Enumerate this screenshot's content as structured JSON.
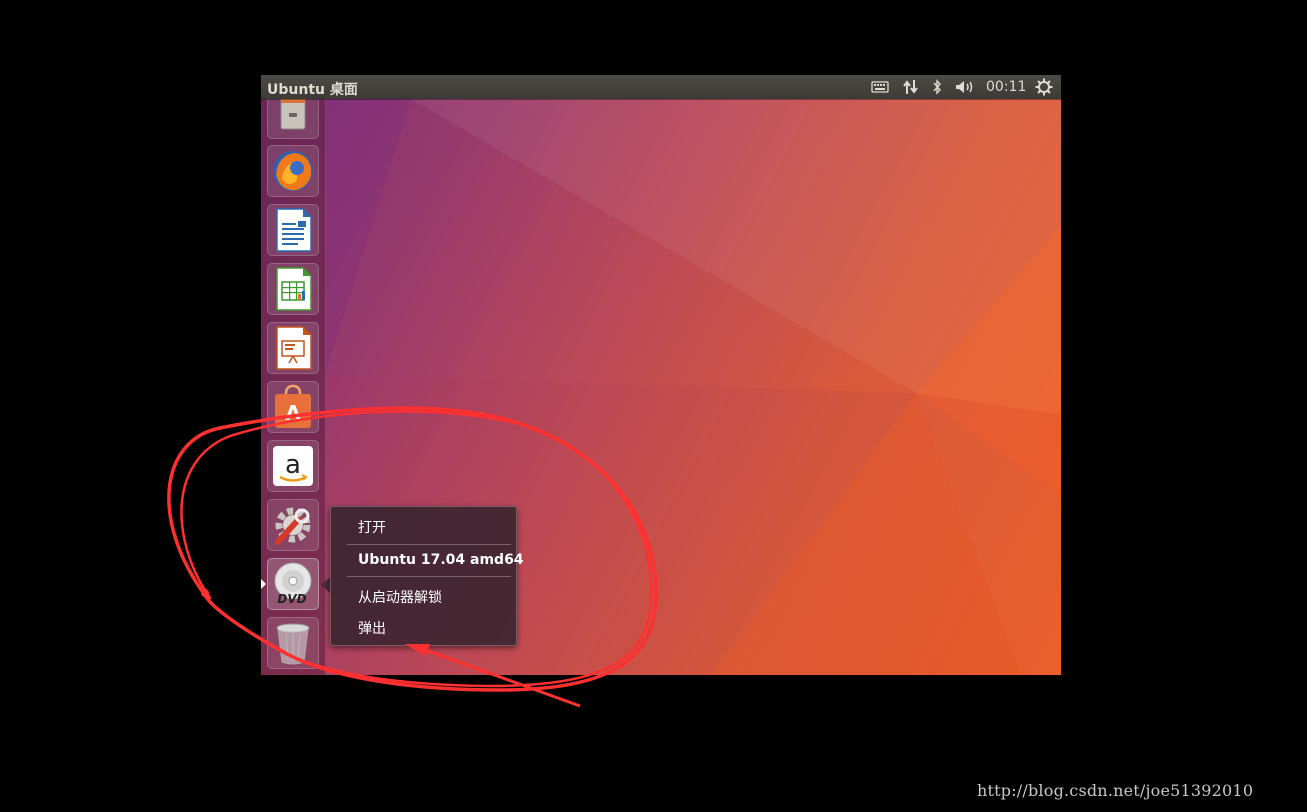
{
  "topbar": {
    "title": "Ubuntu 桌面",
    "clock": "00:11",
    "icons": [
      "keyboard-icon",
      "network-icon",
      "bluetooth-icon",
      "volume-icon",
      "gear-icon"
    ]
  },
  "launcher": {
    "items": [
      {
        "name": "files",
        "icon": "file-cabinet-icon"
      },
      {
        "name": "firefox",
        "icon": "firefox-icon"
      },
      {
        "name": "libreoffice-writer",
        "icon": "writer-icon"
      },
      {
        "name": "libreoffice-calc",
        "icon": "calc-icon"
      },
      {
        "name": "libreoffice-impress",
        "icon": "impress-icon"
      },
      {
        "name": "ubuntu-software",
        "icon": "software-bag-icon"
      },
      {
        "name": "amazon",
        "icon": "amazon-icon",
        "glyph": "a"
      },
      {
        "name": "system-settings",
        "icon": "settings-wrench-icon"
      },
      {
        "name": "dvd",
        "icon": "dvd-icon",
        "glyph": "DVD"
      },
      {
        "name": "trash",
        "icon": "trash-icon"
      }
    ]
  },
  "quicklist": {
    "items": [
      "打开",
      "Ubuntu 17.04 amd64",
      "从启动器解锁",
      "弹出"
    ]
  },
  "annotation": {
    "color": "#ff3030"
  },
  "watermark": "http://blog.csdn.net/joe51392010",
  "colors": {
    "topbar": "#3f3e3a",
    "wallpaper_start": "#7d2f78",
    "wallpaper_end": "#ea5f2c"
  }
}
